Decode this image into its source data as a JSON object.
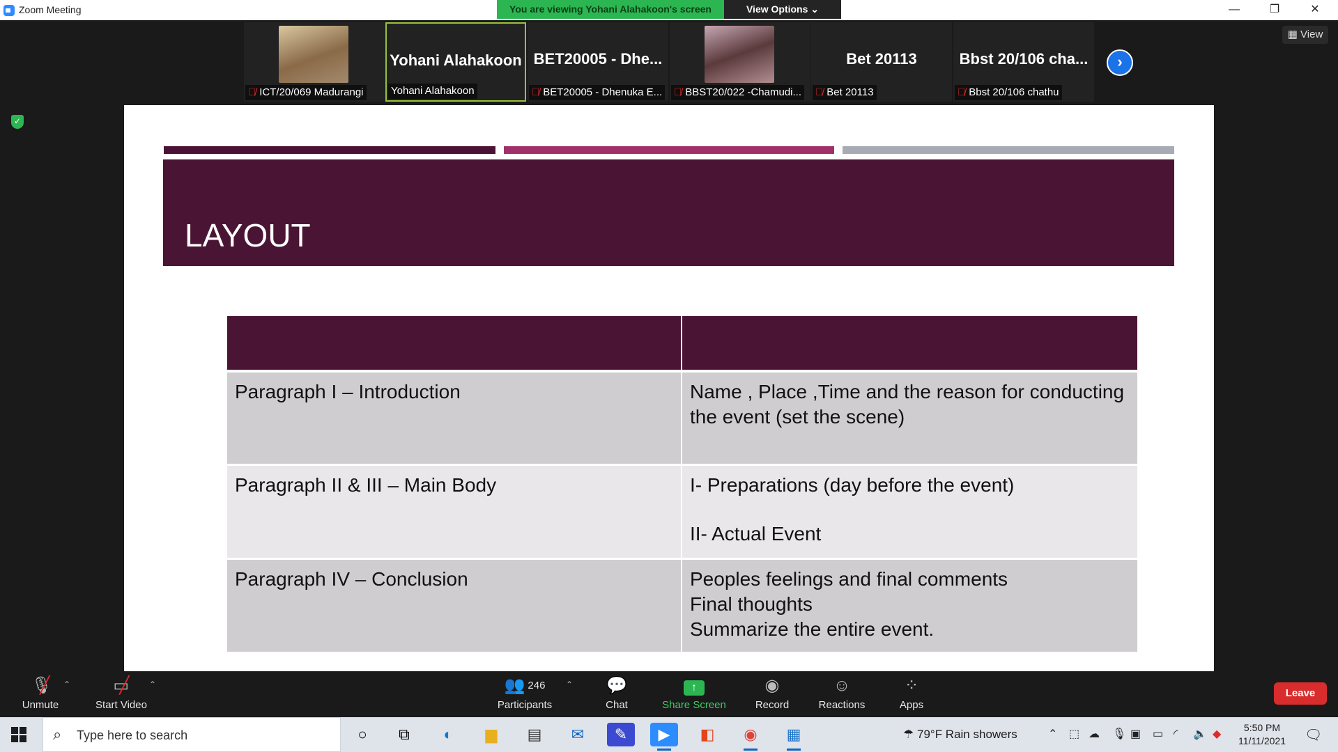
{
  "window": {
    "title": "Zoom Meeting",
    "banner": "You are viewing Yohani Alahakoon's screen",
    "view_options": "View Options",
    "minimize": "—",
    "restore": "❐",
    "close": "✕"
  },
  "gallery": {
    "tiles": [
      {
        "big_name": "",
        "label": "ICT/20/069 Madurangi",
        "has_photo": true
      },
      {
        "big_name": "Yohani Alahakoon",
        "label": "Yohani Alahakoon",
        "active": true
      },
      {
        "big_name": "BET20005  -  Dhe...",
        "label": "BET20005 - Dhenuka E..."
      },
      {
        "big_name": "",
        "label": "BBST20/022 -Chamudi...",
        "has_photo": true
      },
      {
        "big_name": "Bet 20113",
        "label": "Bet 20113"
      },
      {
        "big_name": "Bbst  20/106  cha...",
        "label": "Bbst 20/106 chathu"
      }
    ],
    "next_icon": "›",
    "view_label": "View"
  },
  "slide": {
    "title": "LAYOUT",
    "rows": [
      {
        "left": "Paragraph I – Introduction",
        "right": [
          "Name , Place ,Time and the reason for conducting the event (set the scene)"
        ]
      },
      {
        "left": "Paragraph II & III – Main Body",
        "right": [
          "I- Preparations (day before the event)",
          "II- Actual Event"
        ]
      },
      {
        "left": "Paragraph IV – Conclusion",
        "right": [
          "Peoples feelings and final comments",
          "Final thoughts",
          "Summarize the entire event."
        ]
      }
    ]
  },
  "toolbar": {
    "unmute": "Unmute",
    "start_video": "Start Video",
    "participants": "Participants",
    "participants_count": "246",
    "chat": "Chat",
    "share_screen": "Share Screen",
    "record": "Record",
    "reactions": "Reactions",
    "apps": "Apps",
    "leave": "Leave"
  },
  "taskbar": {
    "search_placeholder": "Type here to search",
    "weather": "79°F  Rain showers",
    "time": "5:50 PM",
    "date": "11/11/2021"
  },
  "colors": {
    "banner_green": "#2bb652",
    "slide_plum": "#4a1534",
    "slide_magenta": "#a03069",
    "leave_red": "#d92d2d",
    "zoom_blue": "#2d8cff"
  }
}
